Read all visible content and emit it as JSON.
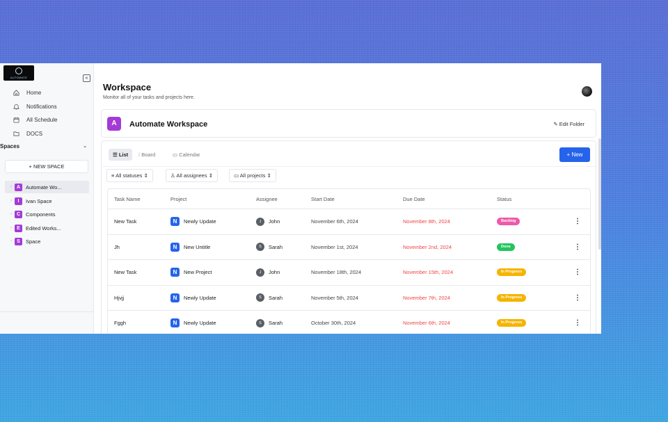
{
  "colors": {
    "accent": "#2563eb",
    "space_badge": "#a43bd6",
    "due_date": "#ef4444",
    "status_backlog": "#ec5ba8",
    "status_done": "#22c55e",
    "status_in_progress": "#f5b400"
  },
  "sidebar": {
    "logo_text": "AUTOMATE",
    "nav": [
      {
        "label": "Home",
        "icon": "home-icon"
      },
      {
        "label": "Notifications",
        "icon": "bell-icon"
      },
      {
        "label": "All Schedule",
        "icon": "calendar-icon"
      },
      {
        "label": "DOCS",
        "icon": "folder-icon"
      }
    ],
    "spaces_header": "Spaces",
    "new_space_label": "+ NEW SPACE",
    "spaces": [
      {
        "letter": "A",
        "name": "Automate Wo..."
      },
      {
        "letter": "I",
        "name": "Ivan Space"
      },
      {
        "letter": "C",
        "name": "Components"
      },
      {
        "letter": "E",
        "name": "Edited Works..."
      },
      {
        "letter": "S",
        "name": "Space"
      }
    ]
  },
  "header": {
    "title": "Workspace",
    "subtitle": "Monitor all of your tasks and projects here."
  },
  "workspace": {
    "badge": "A",
    "name": "Automate Workspace",
    "edit_label": "Edit Folder"
  },
  "views": {
    "list": "List",
    "board": "Board",
    "calendar": "Calendar",
    "new_label": "New"
  },
  "filters": {
    "statuses": "All statuses",
    "assignees": "All assignees",
    "projects": "All projects"
  },
  "table": {
    "columns": [
      "Task Name",
      "Project",
      "Assignee",
      "Start Date",
      "Due Date",
      "Status"
    ],
    "rows": [
      {
        "task": "New Task",
        "project_badge": "N",
        "project": "Newly Update",
        "assignee_initial": "J",
        "assignee": "John",
        "start": "November 6th, 2024",
        "due": "November 8th, 2024",
        "status": "Backlog",
        "status_key": "backlog"
      },
      {
        "task": "Jh",
        "project_badge": "N",
        "project": "New Untitle",
        "assignee_initial": "S",
        "assignee": "Sarah",
        "start": "November 1st, 2024",
        "due": "November 2nd, 2024",
        "status": "Done",
        "status_key": "done"
      },
      {
        "task": "New Task",
        "project_badge": "N",
        "project": "New Project",
        "assignee_initial": "J",
        "assignee": "John",
        "start": "November 18th, 2024",
        "due": "November 15th, 2024",
        "status": "In Progress",
        "status_key": "in_progress"
      },
      {
        "task": "Hjvjj",
        "project_badge": "N",
        "project": "Newly Update",
        "assignee_initial": "S",
        "assignee": "Sarah",
        "start": "November 5th, 2024",
        "due": "November 7th, 2024",
        "status": "In Progress",
        "status_key": "in_progress"
      },
      {
        "task": "Fggh",
        "project_badge": "N",
        "project": "Newly Update",
        "assignee_initial": "S",
        "assignee": "Sarah",
        "start": "October 30th, 2024",
        "due": "November 6th, 2024",
        "status": "In Progress",
        "status_key": "in_progress"
      }
    ]
  }
}
